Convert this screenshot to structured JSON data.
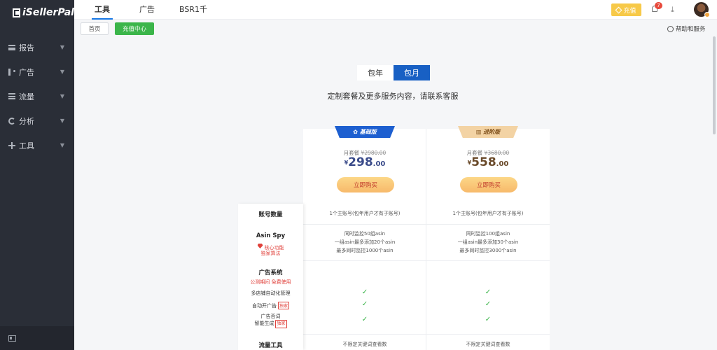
{
  "app": {
    "logo_text": "iSellerPal"
  },
  "sidebar": {
    "items": [
      {
        "label": "报告",
        "icon": "report-icon"
      },
      {
        "label": "广告",
        "icon": "ad-icon"
      },
      {
        "label": "流量",
        "icon": "traffic-icon"
      },
      {
        "label": "分析",
        "icon": "analysis-icon"
      },
      {
        "label": "工具",
        "icon": "tools-icon"
      }
    ]
  },
  "header": {
    "tabs": [
      {
        "label": "工具",
        "active": true
      },
      {
        "label": "广告",
        "active": false
      },
      {
        "label": "BSR1千",
        "active": false
      }
    ],
    "recharge_label": "充值",
    "notification_count": "7",
    "download_glyph": "⤓"
  },
  "breadcrumb": {
    "home_label": "首页",
    "current_label": "充值中心",
    "help_label": "帮助和服务"
  },
  "pricing": {
    "toggle": {
      "yearly": "包年",
      "monthly": "包月",
      "selected": "monthly"
    },
    "subtitle": "定制套餐及更多服务内容，请联系客服",
    "plans": [
      {
        "name": "基础版",
        "icon": "✿",
        "price_prefix": "月套餐",
        "original_price": "¥2980.00",
        "currency": "¥",
        "price_int": "298",
        "price_dec": ".00",
        "buy_label": "立即购买",
        "accent": "#1d5fd0"
      },
      {
        "name": "进阶版",
        "icon": "▥",
        "price_prefix": "月套餐",
        "original_price": "¥3680.00",
        "currency": "¥",
        "price_int": "558",
        "price_dec": ".00",
        "buy_label": "立即购买",
        "accent": "#f3d3a4"
      }
    ]
  },
  "features": {
    "account": {
      "label": "账号数量",
      "base": "1个主账号(包年用户才有子账号)",
      "fast": "1个主账号(包年用户才有子账号)"
    },
    "asin_spy": {
      "label": "Asin Spy",
      "sub1": "核心功能",
      "sub2": "独家算法",
      "base": [
        "同时监控50组asin",
        "一组asin最多添加20个asin",
        "最多同时监控1000个asin"
      ],
      "fast": [
        "同时监控100组asin",
        "一组asin最多添加30个asin",
        "最多同时监控3000个asin"
      ]
    },
    "ad_system": {
      "label": "广告系统",
      "note": "公测期间 免费使用",
      "items": [
        {
          "label": "多店铺自动化管理",
          "tag": ""
        },
        {
          "label": "自动开广告",
          "tag": "独家"
        },
        {
          "label": "广告否词",
          "label2": "智能生成",
          "tag": "独家"
        }
      ],
      "check": "✓"
    },
    "traffic_tools": {
      "label": "流量工具",
      "base": "不限定关键词查看数",
      "fast": "不限定关键词查看数"
    }
  }
}
